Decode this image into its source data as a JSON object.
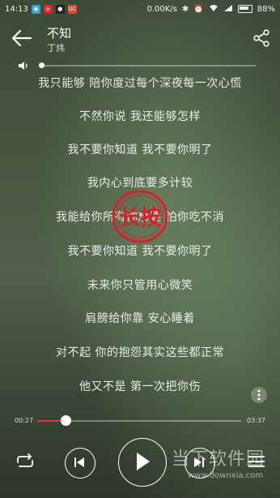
{
  "status_bar": {
    "time": "14:13",
    "app_icon_1": "sina",
    "app_icon_2": "netease",
    "app_icon_3": "qq",
    "app_icon_4_label": "UC",
    "speed": "0.00K/s",
    "battery": "88%"
  },
  "header": {
    "title": "不知",
    "artist": "丁炜"
  },
  "volume": {
    "level": 0.0
  },
  "lyrics": [
    "我只能够 陪你度过每个深夜每一次心慌",
    "不然你说 我还能够怎样",
    "我不要你知道 我不要你明了",
    "我内心到底要多计较",
    "我能给你所有你想要 怕你吃不消",
    "我不要你知道 我不要你明了",
    "未来你只管用心微笑",
    "肩膀给你靠 安心睡着",
    "对不起 你的抱怨其实这些都正常",
    "他又不是 第一次把你伤"
  ],
  "stamp": {
    "text": "长按",
    "color": "#d8202a"
  },
  "progress": {
    "current": "00:27",
    "total": "03:37",
    "fraction": 0.124,
    "accent": "#e0333a"
  },
  "watermark": {
    "text": "当下软件园",
    "url": "www.downxia.com"
  }
}
